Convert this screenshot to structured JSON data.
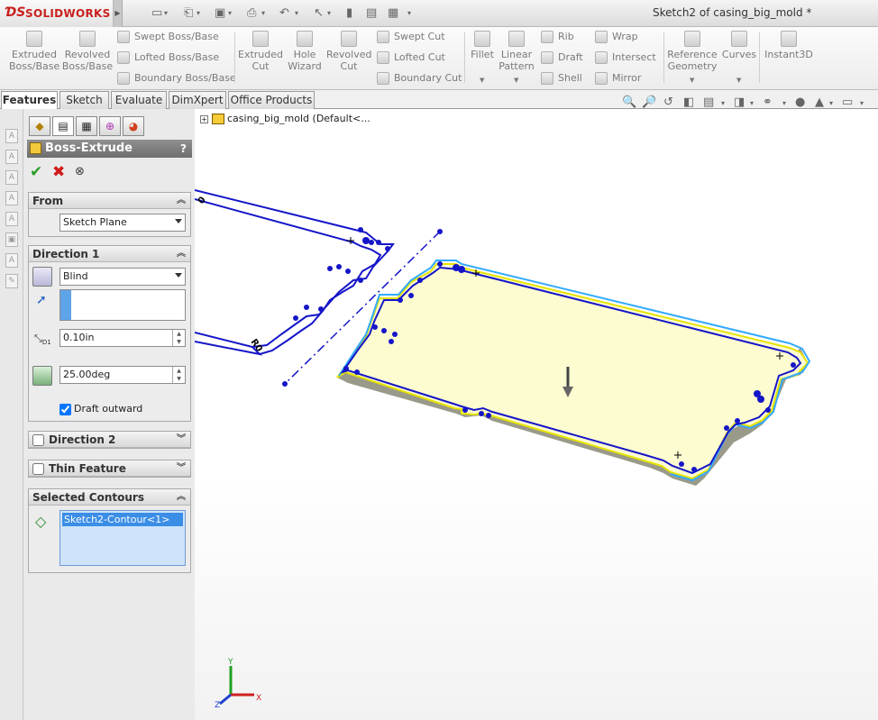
{
  "app": {
    "logo_text": "SOLIDWORKS",
    "doc_title": "Sketch2 of casing_big_mold *"
  },
  "toolbar": {
    "extruded_boss": "Extruded\nBoss/Base",
    "revolved_boss": "Revolved\nBoss/Base",
    "swept_boss": "Swept Boss/Base",
    "lofted_boss": "Lofted Boss/Base",
    "boundary_boss": "Boundary Boss/Base",
    "extruded_cut": "Extruded\nCut",
    "hole_wizard": "Hole\nWizard",
    "revolved_cut": "Revolved\nCut",
    "swept_cut": "Swept Cut",
    "lofted_cut": "Lofted Cut",
    "boundary_cut": "Boundary Cut",
    "fillet": "Fillet",
    "linear_pattern": "Linear\nPattern",
    "rib": "Rib",
    "draft": "Draft",
    "shell": "Shell",
    "wrap": "Wrap",
    "intersect": "Intersect",
    "mirror": "Mirror",
    "reference_geometry": "Reference\nGeometry",
    "curves": "Curves",
    "instant3d": "Instant3D"
  },
  "tabs": [
    "Features",
    "Sketch",
    "Evaluate",
    "DimXpert",
    "Office Products"
  ],
  "tree": {
    "root_label": "casing_big_mold  (Default<..."
  },
  "pm": {
    "title": "Boss-Extrude",
    "help": "?",
    "from": {
      "header": "From",
      "value": "Sketch Plane"
    },
    "direction1": {
      "header": "Direction 1",
      "end_condition": "Blind",
      "depth": "0.10in",
      "draft_angle": "25.00deg",
      "draft_outward_label": "Draft outward",
      "draft_outward": true
    },
    "direction2": {
      "header": "Direction 2",
      "checked": false
    },
    "thin_feature": {
      "header": "Thin Feature",
      "checked": false
    },
    "selected_contours": {
      "header": "Selected Contours",
      "items": [
        "Sketch2-Contour<1>"
      ]
    }
  },
  "triad": {
    "x": "X",
    "y": "Y",
    "z": "Z"
  },
  "colors": {
    "sketch": "#1515c8",
    "face": "#fdfbd0",
    "edge": "#e6e300",
    "highlight": "#33aaff"
  }
}
